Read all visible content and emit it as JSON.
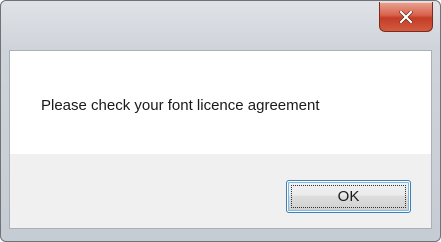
{
  "dialog": {
    "message": "Please check your font licence agreement",
    "ok_label": "OK",
    "close_icon": "close-icon"
  },
  "colors": {
    "close_button": "#c9432c",
    "ok_border": "#3c7fb1",
    "frame": "#cfd4da"
  }
}
